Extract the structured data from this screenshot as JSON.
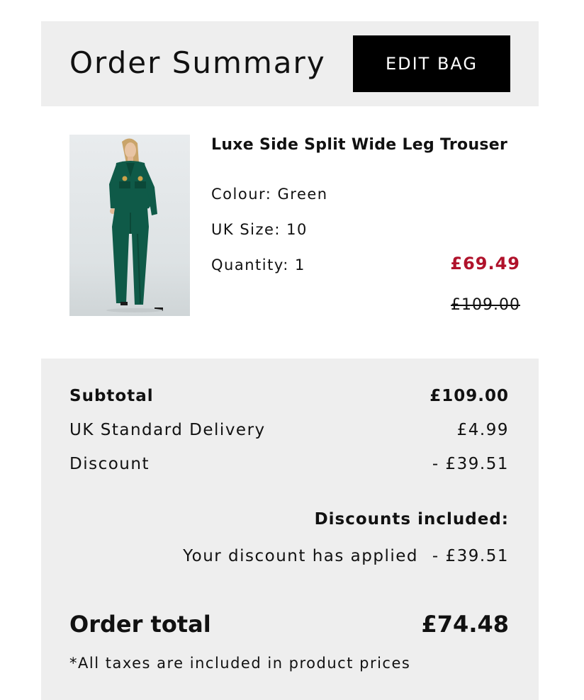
{
  "header": {
    "title": "Order Summary",
    "edit_bag_label": "EDIT BAG"
  },
  "product": {
    "name": "Luxe Side Split Wide Leg Trouser",
    "colour": "Colour: Green",
    "size": "UK Size: 10",
    "quantity": "Quantity: 1",
    "sale_price": "£69.49",
    "original_price": "£109.00",
    "image_icon": "product-photo-green-suit"
  },
  "summary": {
    "subtotal_label": "Subtotal",
    "subtotal_value": "£109.00",
    "delivery_label": "UK Standard Delivery",
    "delivery_value": "£4.99",
    "discount_label": "Discount",
    "discount_value": "- £39.51",
    "discounts_heading": "Discounts included:",
    "discount_applied_label": "Your discount has applied",
    "discount_applied_value": "- £39.51",
    "total_label": "Order total",
    "total_value": "£74.48",
    "tax_note": "*All taxes are included in product prices"
  },
  "colors": {
    "sale_price": "#b0122b",
    "panel_bg": "#eeeeee",
    "button_bg": "#000000"
  }
}
